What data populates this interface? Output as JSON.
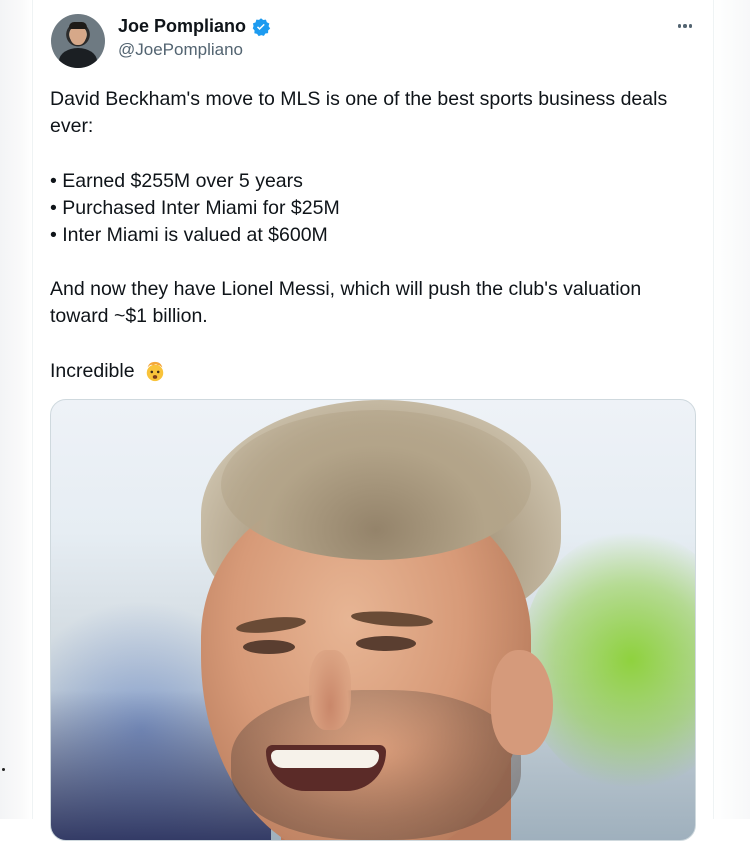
{
  "author": {
    "display_name": "Joe Pompliano",
    "handle": "@JoePompliano",
    "verified": true,
    "verified_color": "#1d9bf0"
  },
  "tweet": {
    "line1": "David Beckham's move to MLS is one of the best sports business deals ever:",
    "bullets": [
      "• Earned $255M over 5 years",
      "• Purchased Inter Miami for $25M",
      "• Inter Miami is valued at $600M"
    ],
    "line2": "And now they have Lionel Messi, which will push the club's valuation toward ~$1 billion.",
    "line3": "Incredible",
    "emoji": "exploding-head-icon"
  },
  "media": {
    "subject": "photo-of-smiling-man"
  },
  "icons": {
    "more": "more-options-icon",
    "verified": "verified-badge-icon"
  },
  "colors": {
    "text": "#0f1419",
    "secondary_text": "#536471",
    "border": "#cfd9de"
  }
}
